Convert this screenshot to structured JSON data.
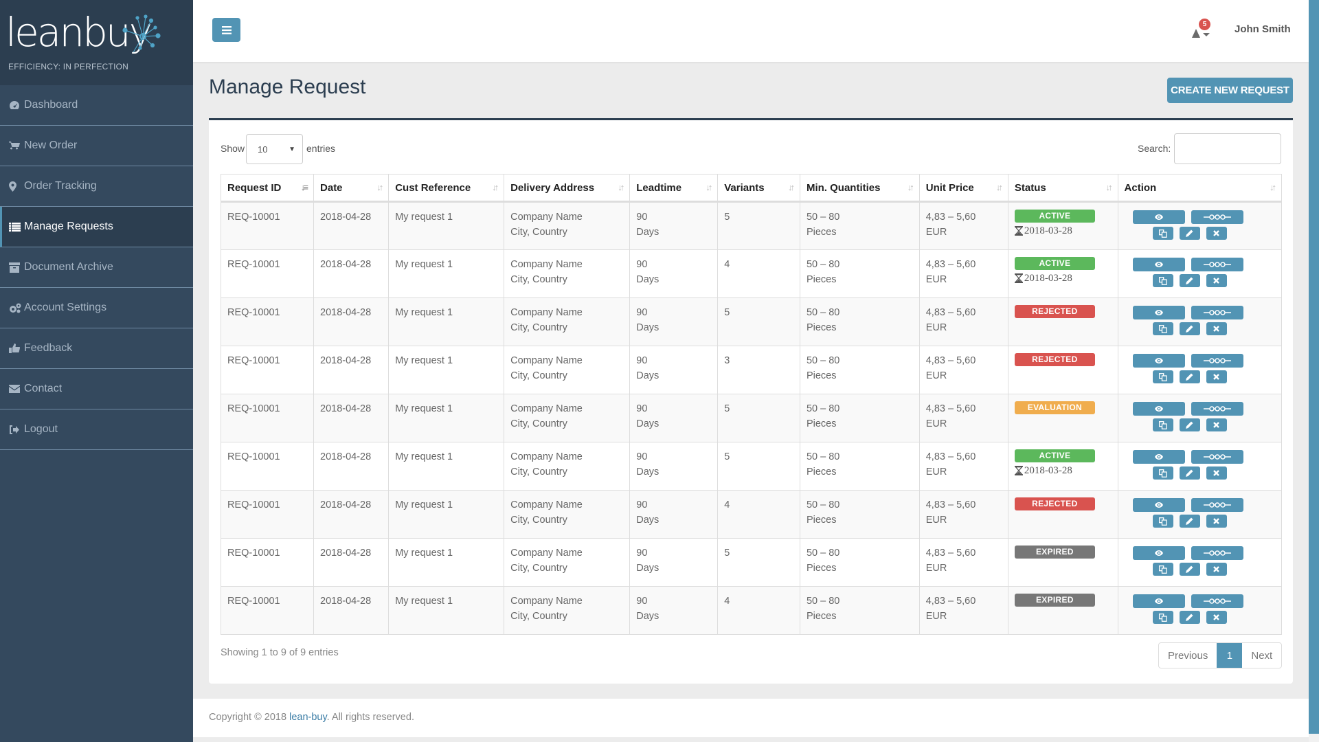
{
  "brand": {
    "name": "leanbuy",
    "tagline": "EFFICIENCY: IN PERFECTION"
  },
  "sidebar": {
    "items": [
      {
        "label": "Dashboard",
        "icon": "dashboard-icon",
        "active": false
      },
      {
        "label": "New Order",
        "icon": "cart-icon",
        "active": false
      },
      {
        "label": "Order Tracking",
        "icon": "map-marker-icon",
        "active": false
      },
      {
        "label": "Manage Requests",
        "icon": "list-icon",
        "active": true
      },
      {
        "label": "Document Archive",
        "icon": "archive-icon",
        "active": false
      },
      {
        "label": "Account Settings",
        "icon": "cogs-icon",
        "active": false
      },
      {
        "label": "Feedback",
        "icon": "thumbs-up-icon",
        "active": false
      },
      {
        "label": "Contact",
        "icon": "envelope-icon",
        "active": false
      },
      {
        "label": "Logout",
        "icon": "sign-out-icon",
        "active": false
      }
    ]
  },
  "header": {
    "notifications_count": "5",
    "user_name": "John Smith"
  },
  "page": {
    "title": "Manage Request",
    "create_button": "CREATE NEW REQUEST"
  },
  "table_controls": {
    "show_label": "Show",
    "page_length": "10",
    "entries_label": "entries",
    "search_label": "Search:",
    "search_value": ""
  },
  "table": {
    "columns": [
      "Request ID",
      "Date",
      "Cust Reference",
      "Delivery Address",
      "Leadtime",
      "Variants",
      "Min. Quantities",
      "Unit Price",
      "Status",
      "Action"
    ],
    "sorted_column": "Request ID",
    "rows": [
      {
        "id": "REQ-10001",
        "date": "2018-04-28",
        "ref": "My request 1",
        "addr1": "Company Name",
        "addr2": "City, Country",
        "lead1": "90",
        "lead2": "Days",
        "variants": "5",
        "qty1": "50 – 80",
        "qty2": "Pieces",
        "price1": "4,83 – 5,60",
        "price2": "EUR",
        "status": "ACTIVE",
        "expiry": "2018-03-28"
      },
      {
        "id": "REQ-10001",
        "date": "2018-04-28",
        "ref": "My request 1",
        "addr1": "Company Name",
        "addr2": "City, Country",
        "lead1": "90",
        "lead2": "Days",
        "variants": "4",
        "qty1": "50 – 80",
        "qty2": "Pieces",
        "price1": "4,83 – 5,60",
        "price2": "EUR",
        "status": "ACTIVE",
        "expiry": "2018-03-28"
      },
      {
        "id": "REQ-10001",
        "date": "2018-04-28",
        "ref": "My request 1",
        "addr1": "Company Name",
        "addr2": "City, Country",
        "lead1": "90",
        "lead2": "Days",
        "variants": "5",
        "qty1": "50 – 80",
        "qty2": "Pieces",
        "price1": "4,83 – 5,60",
        "price2": "EUR",
        "status": "REJECTED",
        "expiry": ""
      },
      {
        "id": "REQ-10001",
        "date": "2018-04-28",
        "ref": "My request 1",
        "addr1": "Company Name",
        "addr2": "City, Country",
        "lead1": "90",
        "lead2": "Days",
        "variants": "3",
        "qty1": "50 – 80",
        "qty2": "Pieces",
        "price1": "4,83 – 5,60",
        "price2": "EUR",
        "status": "REJECTED",
        "expiry": ""
      },
      {
        "id": "REQ-10001",
        "date": "2018-04-28",
        "ref": "My request 1",
        "addr1": "Company Name",
        "addr2": "City, Country",
        "lead1": "90",
        "lead2": "Days",
        "variants": "5",
        "qty1": "50 – 80",
        "qty2": "Pieces",
        "price1": "4,83 – 5,60",
        "price2": "EUR",
        "status": "EVALUATION",
        "expiry": ""
      },
      {
        "id": "REQ-10001",
        "date": "2018-04-28",
        "ref": "My request 1",
        "addr1": "Company Name",
        "addr2": "City, Country",
        "lead1": "90",
        "lead2": "Days",
        "variants": "5",
        "qty1": "50 – 80",
        "qty2": "Pieces",
        "price1": "4,83 – 5,60",
        "price2": "EUR",
        "status": "ACTIVE",
        "expiry": "2018-03-28"
      },
      {
        "id": "REQ-10001",
        "date": "2018-04-28",
        "ref": "My request 1",
        "addr1": "Company Name",
        "addr2": "City, Country",
        "lead1": "90",
        "lead2": "Days",
        "variants": "4",
        "qty1": "50 – 80",
        "qty2": "Pieces",
        "price1": "4,83 – 5,60",
        "price2": "EUR",
        "status": "REJECTED",
        "expiry": ""
      },
      {
        "id": "REQ-10001",
        "date": "2018-04-28",
        "ref": "My request 1",
        "addr1": "Company Name",
        "addr2": "City, Country",
        "lead1": "90",
        "lead2": "Days",
        "variants": "5",
        "qty1": "50 – 80",
        "qty2": "Pieces",
        "price1": "4,83 – 5,60",
        "price2": "EUR",
        "status": "EXPIRED",
        "expiry": ""
      },
      {
        "id": "REQ-10001",
        "date": "2018-04-28",
        "ref": "My request 1",
        "addr1": "Company Name",
        "addr2": "City, Country",
        "lead1": "90",
        "lead2": "Days",
        "variants": "4",
        "qty1": "50 – 80",
        "qty2": "Pieces",
        "price1": "4,83 – 5,60",
        "price2": "EUR",
        "status": "EXPIRED",
        "expiry": ""
      }
    ],
    "row_actions": [
      "view",
      "timeline",
      "copy",
      "edit",
      "delete"
    ]
  },
  "status_colors": {
    "ACTIVE": "#5cb85c",
    "REJECTED": "#d9534f",
    "EVALUATION": "#f0ad4e",
    "EXPIRED": "#777777"
  },
  "colors": {
    "accent": "#5294b4",
    "sidebar": "#34495e",
    "sidebar_dark": "#2c3e50"
  },
  "pagination": {
    "info": "Showing 1 to 9 of 9 entries",
    "previous": "Previous",
    "current": "1",
    "next": "Next"
  },
  "footer": {
    "prefix": "Copyright © 2018 ",
    "link": "lean-buy",
    "suffix": ". All rights reserved."
  }
}
